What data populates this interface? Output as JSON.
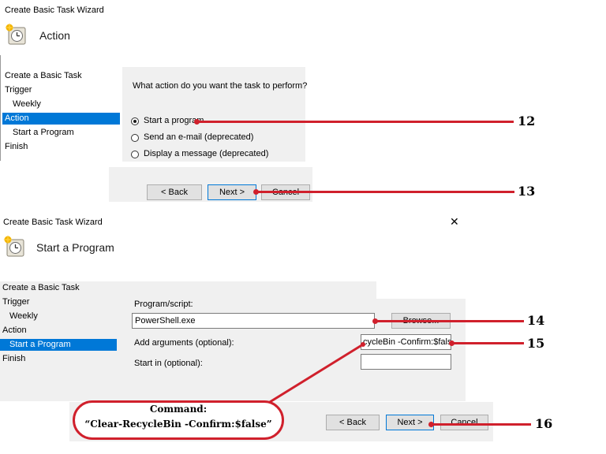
{
  "wizard1": {
    "window_title": "Create Basic Task Wizard",
    "header_title": "Action",
    "nav": [
      "Create a Basic Task",
      "Trigger",
      "Weekly",
      "Action",
      "Start a Program",
      "Finish"
    ],
    "question": "What action do you want the task to perform?",
    "options": [
      "Start a program",
      "Send an e-mail (deprecated)",
      "Display a message (deprecated)"
    ],
    "selected_option": "Start a program",
    "back_label": "< Back",
    "next_label": "Next >",
    "cancel_label": "Cancel"
  },
  "wizard2": {
    "window_title": "Create Basic Task Wizard",
    "close_glyph": "✕",
    "header_title": "Start a Program",
    "nav": [
      "Create a Basic Task",
      "Trigger",
      "Weekly",
      "Action",
      "Start a Program",
      "Finish"
    ],
    "program_label": "Program/script:",
    "program_value": "PowerShell.exe",
    "browse_label": "Browse...",
    "args_label": "Add arguments (optional):",
    "args_value": "cycleBin -Confirm:$false",
    "startin_label": "Start in (optional):",
    "startin_value": "",
    "back_label": "< Back",
    "next_label": "Next >",
    "cancel_label": "Cancel"
  },
  "annotations": {
    "step12": "12",
    "step13": "13",
    "step14": "14",
    "step15": "15",
    "step16": "16",
    "command_title": "Command:",
    "command_text": "“Clear-RecycleBin -Confirm:$false”",
    "color": "#d0202c"
  },
  "icons": {
    "task_icon": "scheduled-task-clock-icon"
  }
}
